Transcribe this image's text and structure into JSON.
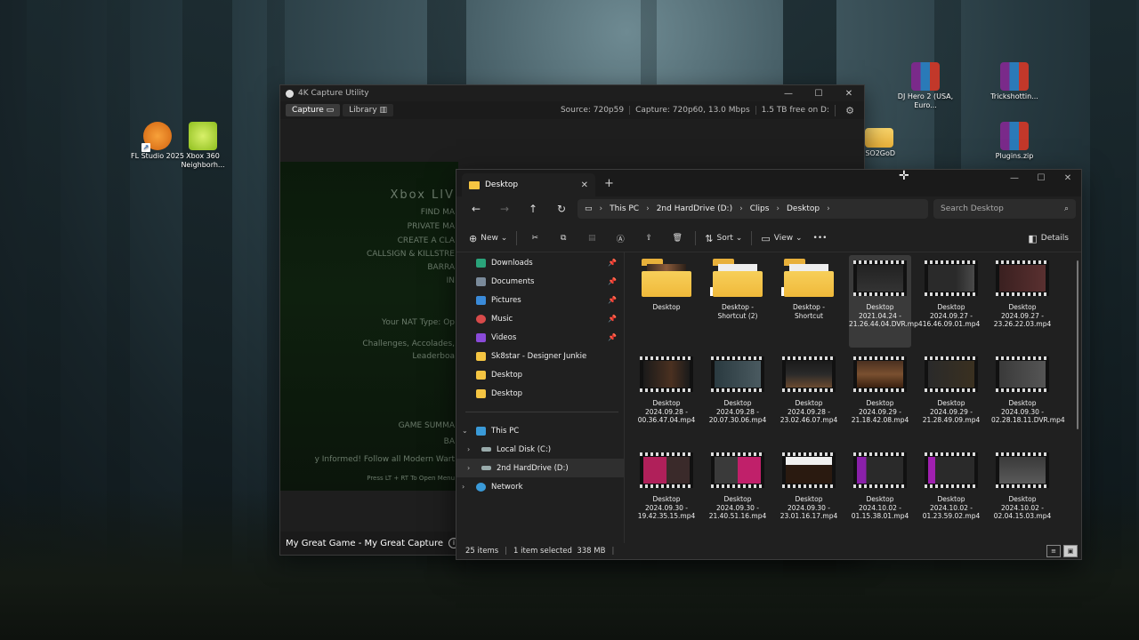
{
  "desktop": {
    "icons": [
      {
        "label": "FL Studio 2025",
        "icon": "fl-studio-icon"
      },
      {
        "label": "Xbox 360 Neighborh...",
        "icon": "xbox-neighborhood-icon"
      },
      {
        "label": "DJ Hero 2 (USA, Euro...",
        "icon": "winrar-archive-icon"
      },
      {
        "label": "Trickshottin...",
        "icon": "winrar-archive-icon"
      },
      {
        "label": "ISO2GoD",
        "icon": "folder-icon"
      },
      {
        "label": "Plugins.zip",
        "icon": "winrar-archive-icon"
      }
    ]
  },
  "capture": {
    "title": "4K Capture Utility",
    "tabs": [
      "Capture",
      "Library"
    ],
    "source": "Source: 720p59",
    "capture_rate": "Capture: 720p60, 13.0 Mbps",
    "free": "1.5 TB free on D:",
    "preview_lines": [
      "Xbox LIV",
      "FIND MA",
      "PRIVATE MA",
      "CREATE A CLA",
      "CALLSIGN & KILLSTRE",
      "BARRA",
      "IN",
      "Your NAT Type: Op",
      "Challenges, Accolades,",
      "Leaderboa",
      "GAME SUMMA",
      "BA",
      "y Informed! Follow all Modern Wart",
      "Press LT + RT To Open Menu"
    ],
    "bottom_title": "My Great Game - My Great Capture"
  },
  "explorer": {
    "tab_title": "Desktop",
    "breadcrumb": [
      "This PC",
      "2nd HardDrive (D:)",
      "Clips",
      "Desktop"
    ],
    "search_placeholder": "Search Desktop",
    "commands": {
      "new": "New",
      "sort": "Sort",
      "view": "View",
      "details": "Details"
    },
    "sidebar": [
      {
        "label": "Downloads",
        "icon": "download-icon",
        "pinned": true
      },
      {
        "label": "Documents",
        "icon": "document-icon",
        "pinned": true
      },
      {
        "label": "Pictures",
        "icon": "pictures-icon",
        "pinned": true
      },
      {
        "label": "Music",
        "icon": "music-icon",
        "pinned": true
      },
      {
        "label": "Videos",
        "icon": "videos-icon",
        "pinned": true
      },
      {
        "label": "Sk8star - Designer Junkie",
        "icon": "folder-icon",
        "pinned": false
      },
      {
        "label": "Desktop",
        "icon": "folder-icon",
        "pinned": false
      },
      {
        "label": "Desktop",
        "icon": "folder-icon",
        "pinned": false
      }
    ],
    "tree": [
      {
        "label": "This PC",
        "icon": "pc-icon"
      },
      {
        "label": "Local Disk (C:)",
        "icon": "drive-icon"
      },
      {
        "label": "2nd HardDrive (D:)",
        "icon": "drive-icon"
      },
      {
        "label": "Network",
        "icon": "network-icon"
      }
    ],
    "items": [
      {
        "name": "Desktop",
        "type": "folder"
      },
      {
        "name": "Desktop - Shortcut (2)",
        "type": "folder-shortcut"
      },
      {
        "name": "Desktop - Shortcut",
        "type": "folder-shortcut"
      },
      {
        "name": "Desktop 2021.04.24 - 21.26.44.04.DVR.mp4",
        "type": "video",
        "selected": true
      },
      {
        "name": "Desktop 2024.09.27 - 16.46.09.01.mp4",
        "type": "video"
      },
      {
        "name": "Desktop 2024.09.27 - 23.26.22.03.mp4",
        "type": "video"
      },
      {
        "name": "Desktop 2024.09.28 - 00.36.47.04.mp4",
        "type": "video"
      },
      {
        "name": "Desktop 2024.09.28 - 20.07.30.06.mp4",
        "type": "video"
      },
      {
        "name": "Desktop 2024.09.28 - 23.02.46.07.mp4",
        "type": "video"
      },
      {
        "name": "Desktop 2024.09.29 - 21.18.42.08.mp4",
        "type": "video"
      },
      {
        "name": "Desktop 2024.09.29 - 21.28.49.09.mp4",
        "type": "video"
      },
      {
        "name": "Desktop 2024.09.30 - 02.28.18.11.DVR.mp4",
        "type": "video"
      },
      {
        "name": "Desktop 2024.09.30 - 19.42.35.15.mp4",
        "type": "video"
      },
      {
        "name": "Desktop 2024.09.30 - 21.40.51.16.mp4",
        "type": "video"
      },
      {
        "name": "Desktop 2024.09.30 - 23.01.16.17.mp4",
        "type": "video"
      },
      {
        "name": "Desktop 2024.10.02 - 01.15.38.01.mp4",
        "type": "video"
      },
      {
        "name": "Desktop 2024.10.02 - 01.23.59.02.mp4",
        "type": "video"
      },
      {
        "name": "Desktop 2024.10.02 - 02.04.15.03.mp4",
        "type": "video"
      }
    ],
    "status": {
      "count": "25 items",
      "selected": "1 item selected",
      "size": "338 MB"
    }
  }
}
